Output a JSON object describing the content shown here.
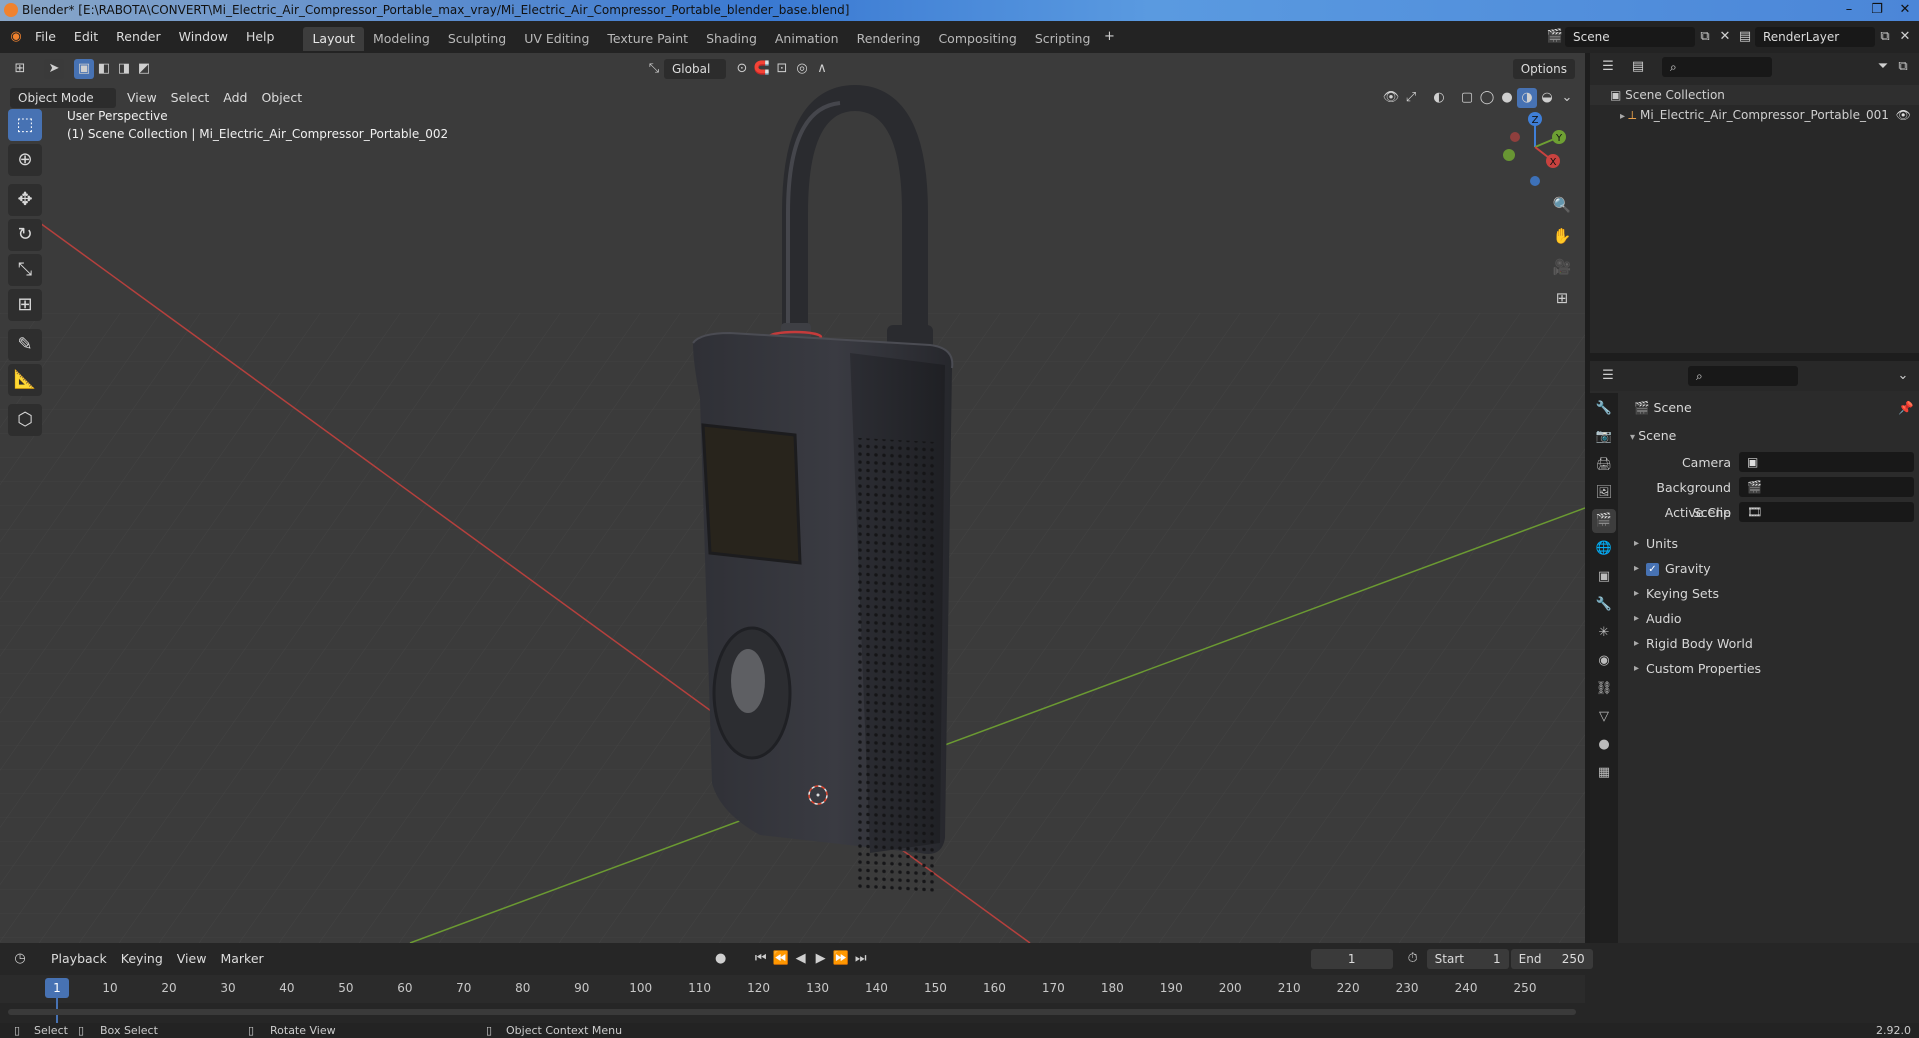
{
  "window": {
    "title": "Blender* [E:\\RABOTA\\CONVERT\\Mi_Electric_Air_Compressor_Portable_max_vray/Mi_Electric_Air_Compressor_Portable_blender_base.blend]"
  },
  "menu": [
    "File",
    "Edit",
    "Render",
    "Window",
    "Help"
  ],
  "workspaces": [
    "Layout",
    "Modeling",
    "Sculpting",
    "UV Editing",
    "Texture Paint",
    "Shading",
    "Animation",
    "Rendering",
    "Compositing",
    "Scripting"
  ],
  "scene_field": "Scene",
  "renderlayer_field": "RenderLayer",
  "viewport": {
    "transform_orientation": "Global",
    "options_label": "Options",
    "mode": "Object Mode",
    "header_menus": [
      "View",
      "Select",
      "Add",
      "Object"
    ],
    "perspective_label": "User Perspective",
    "collection_label": "(1) Scene Collection | Mi_Electric_Air_Compressor_Portable_002"
  },
  "gizmo": {
    "x": "X",
    "y": "Y",
    "z": "Z"
  },
  "outliner": {
    "root": "Scene Collection",
    "items": [
      "Mi_Electric_Air_Compressor_Portable_001"
    ]
  },
  "properties": {
    "header": "Scene",
    "section": "Scene",
    "fields": [
      {
        "label": "Camera"
      },
      {
        "label": "Background Scene"
      },
      {
        "label": "Active Clip"
      }
    ],
    "subsections": [
      "Units",
      "Gravity",
      "Keying Sets",
      "Audio",
      "Rigid Body World",
      "Custom Properties"
    ]
  },
  "timeline": {
    "menus": [
      "Playback",
      "Keying",
      "View",
      "Marker"
    ],
    "current_frame": "1",
    "start_label": "Start",
    "start_value": "1",
    "end_label": "End",
    "end_value": "250",
    "ruler_ticks": [
      "1",
      "10",
      "20",
      "30",
      "40",
      "50",
      "60",
      "70",
      "80",
      "90",
      "100",
      "110",
      "120",
      "130",
      "140",
      "150",
      "160",
      "170",
      "180",
      "190",
      "200",
      "210",
      "220",
      "230",
      "240",
      "250"
    ]
  },
  "statusbar": {
    "select": "Select",
    "box_select": "Box Select",
    "rotate_view": "Rotate View",
    "context_menu": "Object Context Menu",
    "version": "2.92.0"
  },
  "colors": {
    "accent": "#4772b3",
    "viewport_bg": "#3d3d3d",
    "x_axis": "#c8423f",
    "y_axis": "#6ea033",
    "z_axis": "#3f7fd8"
  }
}
